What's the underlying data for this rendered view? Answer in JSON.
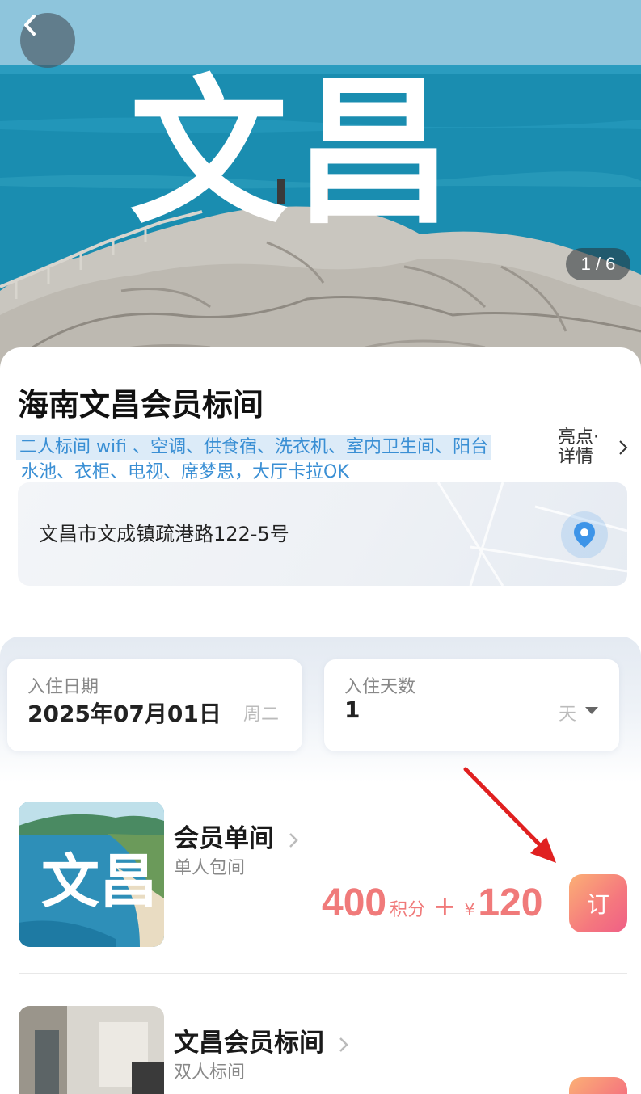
{
  "hero": {
    "title": "文昌",
    "image_counter": "1 / 6",
    "back_icon": "chevron-left-icon"
  },
  "hotel": {
    "name": "海南文昌会员标间",
    "amenities_line1": "二人标间 wifi 、空调、供食宿、洗衣机、室内卫生间、阳台",
    "amenities_line2": "水池、衣柜、电视、席梦思，大厅卡拉OK",
    "highlights_label_1": "亮点·",
    "highlights_label_2": "详情",
    "address": "文昌市文成镇疏港路122-5号"
  },
  "booking": {
    "checkin_label": "入住日期",
    "checkin_date": "2025年07月01日",
    "checkin_weekday": "周二",
    "nights_label": "入住天数",
    "nights_value": "1",
    "nights_unit": "天"
  },
  "rooms": [
    {
      "name": "会员单间",
      "subtitle": "单人包间",
      "thumb_text": "文昌",
      "points": "400",
      "points_unit": "积分",
      "plus": "+",
      "currency": "¥",
      "cash": "120",
      "book_label": "订"
    },
    {
      "name": "文昌会员标间",
      "subtitle": "双人标间",
      "book_label": "订"
    }
  ],
  "colors": {
    "price": "#f07a7a",
    "link": "#3a8fd4",
    "book_gradient_start": "#fbb075",
    "book_gradient_end": "#ef5f86",
    "annotation_arrow": "#e02020"
  }
}
